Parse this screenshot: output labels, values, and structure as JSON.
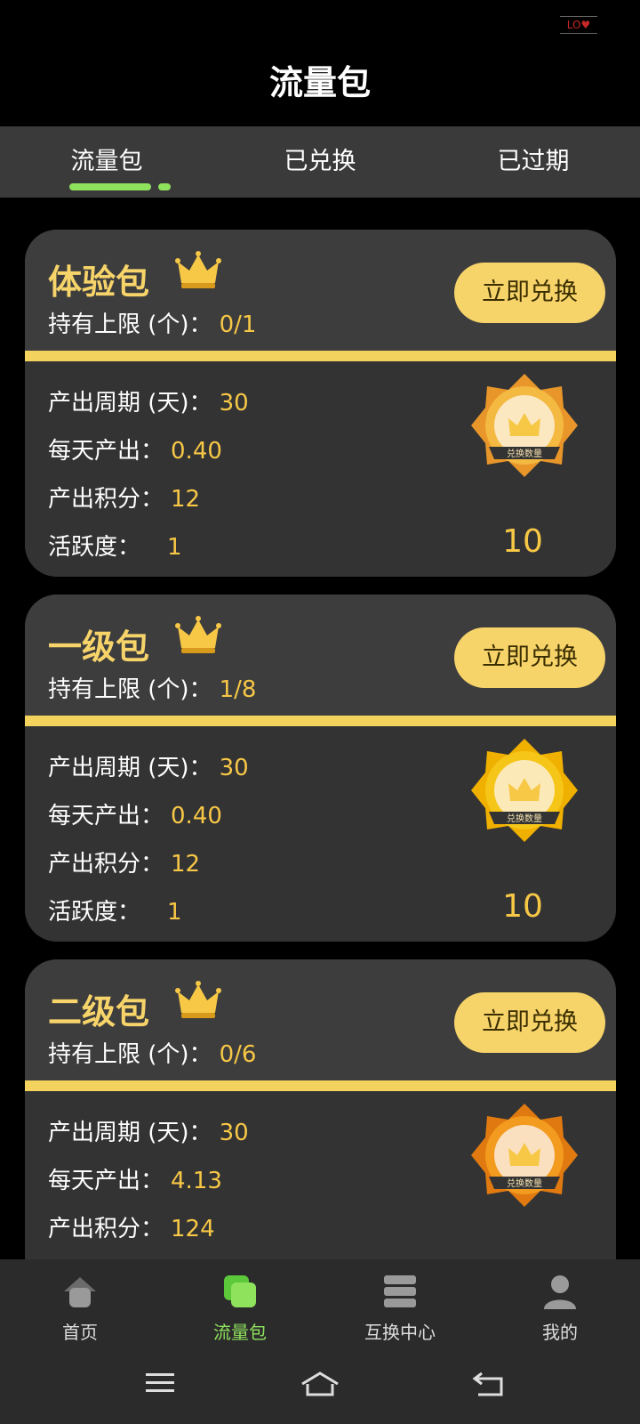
{
  "status": {
    "logo_text": "LO♥"
  },
  "header": {
    "title": "流量包"
  },
  "tabs": [
    {
      "label": "流量包"
    },
    {
      "label": "已兑换"
    },
    {
      "label": "已过期"
    }
  ],
  "cards": [
    {
      "name": "体验包",
      "limit_label": "持有上限 (个)：",
      "limit_value": "0/1",
      "button_label": "立即兑换",
      "period_label": "产出周期 (天)：",
      "period_value": "30",
      "daily_label": "每天产出：",
      "daily_value": "0.40",
      "points_label": "产出积分：",
      "points_value": "12",
      "activity_label": "活跃度：",
      "activity_value": "1",
      "medal_label": "兑换数量",
      "count": "10",
      "medal_color": "#f3b940"
    },
    {
      "name": "一级包",
      "limit_label": "持有上限 (个)：",
      "limit_value": "1/8",
      "button_label": "立即兑换",
      "period_label": "产出周期 (天)：",
      "period_value": "30",
      "daily_label": "每天产出：",
      "daily_value": "0.40",
      "points_label": "产出积分：",
      "points_value": "12",
      "activity_label": "活跃度：",
      "activity_value": "1",
      "medal_label": "兑换数量",
      "count": "10",
      "medal_color": "#f5c518"
    },
    {
      "name": "二级包",
      "limit_label": "持有上限 (个)：",
      "limit_value": "0/6",
      "button_label": "立即兑换",
      "period_label": "产出周期 (天)：",
      "period_value": "30",
      "daily_label": "每天产出：",
      "daily_value": "4.13",
      "points_label": "产出积分：",
      "points_value": "124",
      "medal_label": "兑换数量",
      "medal_color": "#f29b1e"
    }
  ],
  "nav": [
    {
      "label": "首页",
      "icon": "home-icon"
    },
    {
      "label": "流量包",
      "icon": "package-icon"
    },
    {
      "label": "互换中心",
      "icon": "exchange-center-icon"
    },
    {
      "label": "我的",
      "icon": "profile-icon"
    }
  ],
  "colors": {
    "accent_green": "#8fe25c",
    "accent_gold": "#f7d46a",
    "value_gold": "#f7c746"
  }
}
